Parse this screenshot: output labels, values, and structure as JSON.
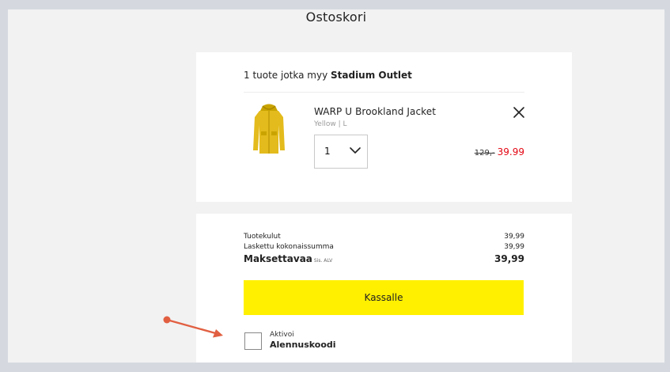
{
  "page": {
    "title": "Ostoskori"
  },
  "cart": {
    "seller_prefix": "1 tuote jotka myy ",
    "seller_name": "Stadium Outlet",
    "item": {
      "name": "WARP U Brookland Jacket",
      "variant": "Yellow |  L",
      "quantity": "1",
      "price_old": "129,-",
      "price_new": "39.99",
      "image_icon": "yellow-jacket-image",
      "remove_icon": "close-icon"
    }
  },
  "summary": {
    "product_costs_label": "Tuotekulut",
    "product_costs_value": "39,99",
    "calculated_total_label": "Laskettu kokonaissumma",
    "calculated_total_value": "39,99",
    "to_pay_label": "Maksettavaa",
    "to_pay_note": "Sis. ALV",
    "to_pay_value": "39,99",
    "checkout_label": "Kassalle"
  },
  "discount": {
    "small_label": "Aktivoi",
    "label": "Alennuskoodi"
  },
  "colors": {
    "accent_yellow": "#fff000",
    "sale_red": "#e30613",
    "annotation": "#e15f41"
  }
}
